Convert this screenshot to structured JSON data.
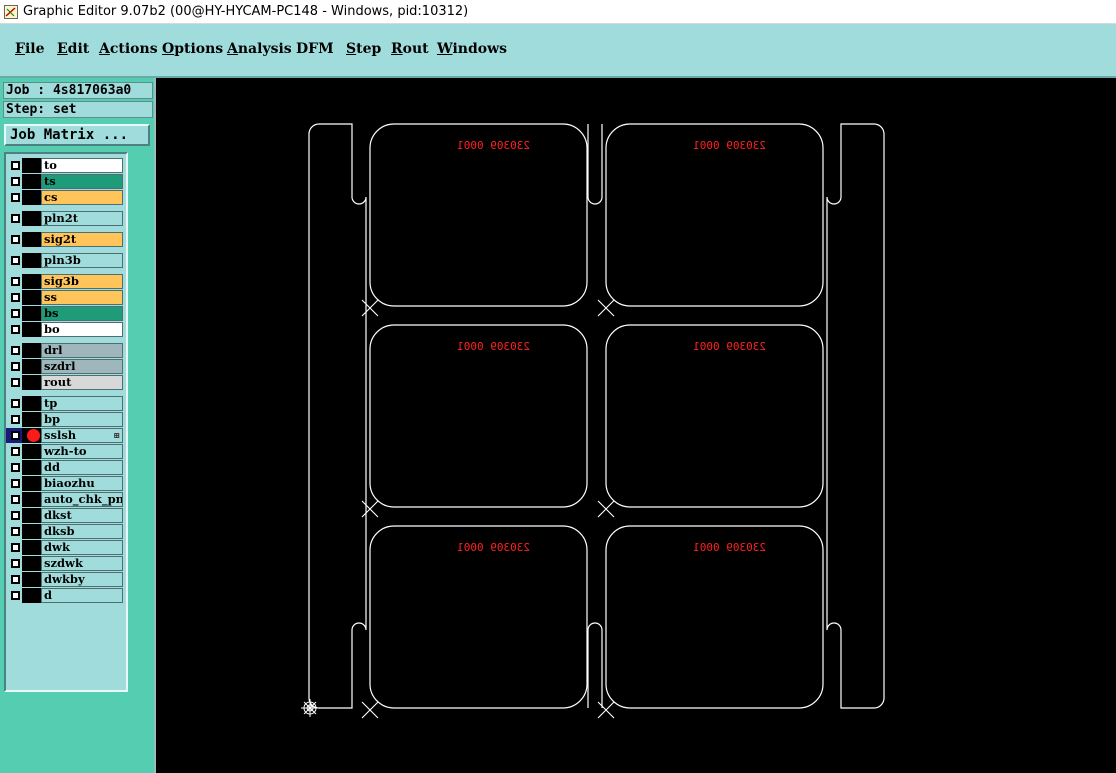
{
  "window": {
    "title": "Graphic Editor 9.07b2 (00@HY-HYCAM-PC148 - Windows, pid:10312)",
    "icon": "graphic-editor-app-icon"
  },
  "menu": {
    "items": [
      {
        "id": "file",
        "accel": "F",
        "rest": "ile"
      },
      {
        "id": "edit",
        "accel": "E",
        "rest": "dit"
      },
      {
        "id": "actions",
        "accel": "A",
        "rest": "ctions"
      },
      {
        "id": "options",
        "accel": "O",
        "rest": "ptions"
      },
      {
        "id": "analysis",
        "accel": "A",
        "rest": "nalysis"
      },
      {
        "id": "dfm",
        "accel": "",
        "rest": "DFM"
      },
      {
        "id": "step",
        "accel": "S",
        "rest": "tep"
      },
      {
        "id": "rout",
        "accel": "R",
        "rest": "out"
      },
      {
        "id": "windows",
        "accel": "W",
        "rest": "indows"
      }
    ]
  },
  "job": {
    "job_text": "Job : 4s817063a0",
    "step_text": "Step: set",
    "matrix_button": "Job Matrix ..."
  },
  "layers": [
    {
      "name": "to",
      "color": "#ffffff"
    },
    {
      "name": "ts",
      "color": "#1e9c7a"
    },
    {
      "name": "cs",
      "color": "#ffc55a"
    },
    {
      "name": "pln2t",
      "color": "#a0dcdc"
    },
    {
      "name": "sig2t",
      "color": "#ffc55a"
    },
    {
      "name": "pln3b",
      "color": "#a0dcdc"
    },
    {
      "name": "sig3b",
      "color": "#ffc55a"
    },
    {
      "name": "ss",
      "color": "#ffc55a"
    },
    {
      "name": "bs",
      "color": "#1e9c7a"
    },
    {
      "name": "bo",
      "color": "#ffffff"
    },
    {
      "name": "drl",
      "color": "#9fb6bc"
    },
    {
      "name": "szdrl",
      "color": "#9fb6bc"
    },
    {
      "name": "rout",
      "color": "#d8d8d8"
    },
    {
      "name": "tp",
      "color": "#a0dcdc"
    },
    {
      "name": "bp",
      "color": "#a0dcdc"
    },
    {
      "name": "sslsh",
      "color": "#a0dcdc",
      "active": true,
      "affected_mark": "⊞"
    },
    {
      "name": "wzh-to",
      "color": "#a0dcdc"
    },
    {
      "name": "dd",
      "color": "#a0dcdc"
    },
    {
      "name": "biaozhu",
      "color": "#a0dcdc"
    },
    {
      "name": "auto_chk_pn",
      "color": "#a0dcdc"
    },
    {
      "name": "dkst",
      "color": "#a0dcdc"
    },
    {
      "name": "dksb",
      "color": "#a0dcdc"
    },
    {
      "name": "dwk",
      "color": "#a0dcdc"
    },
    {
      "name": "szdwk",
      "color": "#a0dcdc"
    },
    {
      "name": "dwkby",
      "color": "#a0dcdc"
    },
    {
      "name": "d",
      "color": "#a0dcdc"
    }
  ],
  "canvas": {
    "background": "#000000",
    "outline_color": "#ffffff",
    "label_color": "#ff2020",
    "board_label": "230309 0001",
    "board_label_mirrored": true,
    "grid": {
      "rows": 3,
      "columns": 2
    }
  }
}
